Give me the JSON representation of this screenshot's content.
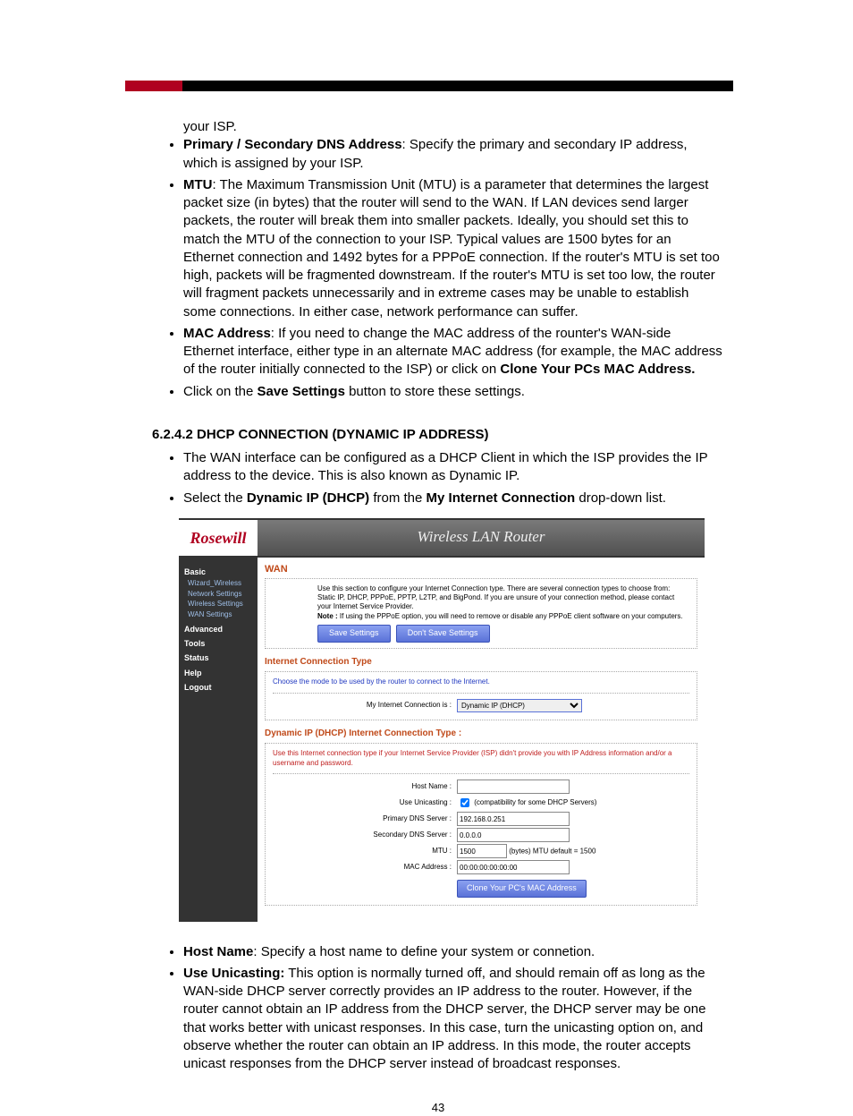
{
  "intro_fragment": "your ISP.",
  "bullets_top": [
    {
      "bold": "Primary / Secondary DNS Address",
      "rest": ": Specify the primary and secondary IP address, which is assigned by your ISP."
    },
    {
      "bold": "MTU",
      "rest": ": The Maximum Transmission Unit (MTU) is a parameter that determines the largest packet size (in bytes) that the router will send to the WAN. If LAN devices send larger packets, the router will break them into smaller packets. Ideally, you should set this to match the MTU of the connection to your ISP. Typical values are 1500 bytes for an Ethernet connection and 1492 bytes for a PPPoE connection. If the router's MTU is set too high, packets will be fragmented downstream. If the router's MTU is set too low, the router will fragment packets unnecessarily and in extreme cases may be unable to establish some connections. In either case, network performance can suffer."
    },
    {
      "bold": "MAC Address",
      "rest_pre": ": If you need to change the MAC address of the rounter's WAN-side Ethernet interface, either type in an alternate MAC address (for example, the MAC address of the router initially connected to the ISP) or click on ",
      "bold2": "Clone Your PCs MAC Address."
    },
    {
      "rest_pre": "Click on the ",
      "bold2": "Save Settings",
      "rest_post": " button to store these settings."
    }
  ],
  "section_heading": "6.2.4.2  DHCP CONNECTION (DYNAMIC IP ADDRESS)",
  "section_bullets": [
    "The WAN interface can be configured as a DHCP Client in which the ISP provides the IP address to the device. This is also known as Dynamic IP.",
    {
      "pre": "Select the ",
      "b1": "Dynamic IP (DHCP)",
      "mid": " from the ",
      "b2": "My Internet Connection",
      "post": " drop-down list."
    }
  ],
  "router": {
    "logo": "Rosewill",
    "title": "Wireless LAN Router",
    "nav": {
      "groups": [
        {
          "head": "Basic",
          "items": [
            "Wizard_Wireless",
            "Network Settings",
            "Wireless Settings",
            "WAN Settings"
          ]
        },
        {
          "head": "Advanced",
          "items": []
        },
        {
          "head": "Tools",
          "items": []
        },
        {
          "head": "Status",
          "items": []
        },
        {
          "head": "Help",
          "items": []
        },
        {
          "head": "Logout",
          "items": []
        }
      ]
    },
    "panel_title": "WAN",
    "intro1": "Use this section to configure your Internet Connection type. There are several connection types to choose from: Static IP, DHCP, PPPoE, PPTP, L2TP, and BigPond. If you are unsure of your connection method, please contact your Internet Service Provider.",
    "intro_note_label": "Note :",
    "intro_note": " If using the PPPoE option, you will need to remove or disable any PPPoE client software on your computers.",
    "save_btn": "Save Settings",
    "dont_save_btn": "Don't Save Settings",
    "conn_type_title": "Internet Connection Type",
    "conn_type_desc": "Choose the mode to be used by the router to connect to the Internet.",
    "conn_label": "My Internet Connection is :",
    "conn_value": "Dynamic IP (DHCP)",
    "dyn_title": "Dynamic IP (DHCP) Internet Connection Type :",
    "dyn_desc": "Use this Internet connection type if your Internet Service Provider (ISP) didn't provide you with IP Address information and/or a username and password.",
    "fields": {
      "host_label": "Host Name :",
      "host_value": "",
      "unicast_label": "Use Unicasting :",
      "unicast_hint": "(compatibility for some DHCP Servers)",
      "pdns_label": "Primary DNS Server :",
      "pdns_value": "192.168.0.251",
      "sdns_label": "Secondary DNS Server :",
      "sdns_value": "0.0.0.0",
      "mtu_label": "MTU :",
      "mtu_value": "1500",
      "mtu_hint": "(bytes) MTU default = 1500",
      "mac_label": "MAC Address :",
      "mac_value": "00:00:00:00:00:00",
      "clone_btn": "Clone Your PC's MAC Address"
    }
  },
  "bullets_bottom": [
    {
      "bold": "Host Name",
      "rest": ": Specify a host name to define your system or connetion."
    },
    {
      "bold": "Use Unicasting:",
      "rest": " This option is normally turned off, and should remain off as long as the WAN-side DHCP server correctly provides an IP address to the router. However, if the router cannot obtain an IP address from the DHCP server, the DHCP server may be one that works better with unicast responses. In this case, turn the unicasting option on, and observe whether the router can obtain an IP address. In this mode, the router accepts unicast responses from the DHCP server instead of broadcast responses."
    }
  ],
  "page_number": "43"
}
